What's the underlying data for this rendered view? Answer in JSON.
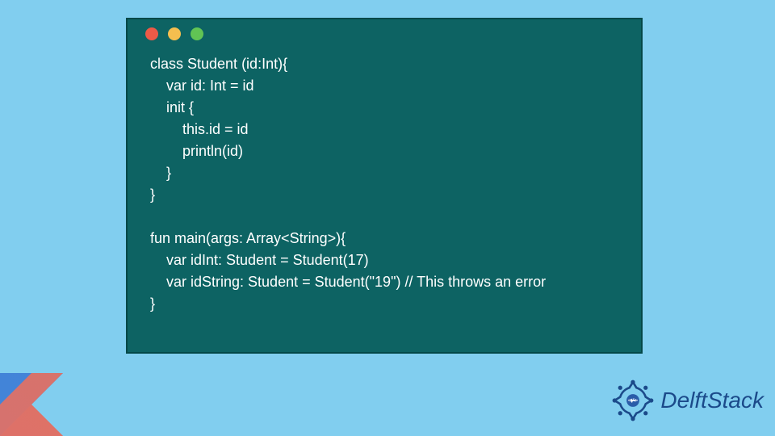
{
  "window": {
    "dots": [
      "#ec5a47",
      "#f5be4f",
      "#61c454"
    ]
  },
  "code": {
    "lines": [
      "class Student (id:Int){",
      "    var id: Int = id",
      "    init {",
      "        this.id = id",
      "        println(id)",
      "    }",
      "}",
      "",
      "fun main(args: Array<String>){",
      "    var idInt: Student = Student(17)",
      "    var idString: Student = Student(\"19\") // This throws an error",
      "}"
    ]
  },
  "brand": {
    "name": "DelftStack"
  },
  "logos": {
    "kotlin": "kotlin-logo",
    "delft": "delft-badge"
  }
}
